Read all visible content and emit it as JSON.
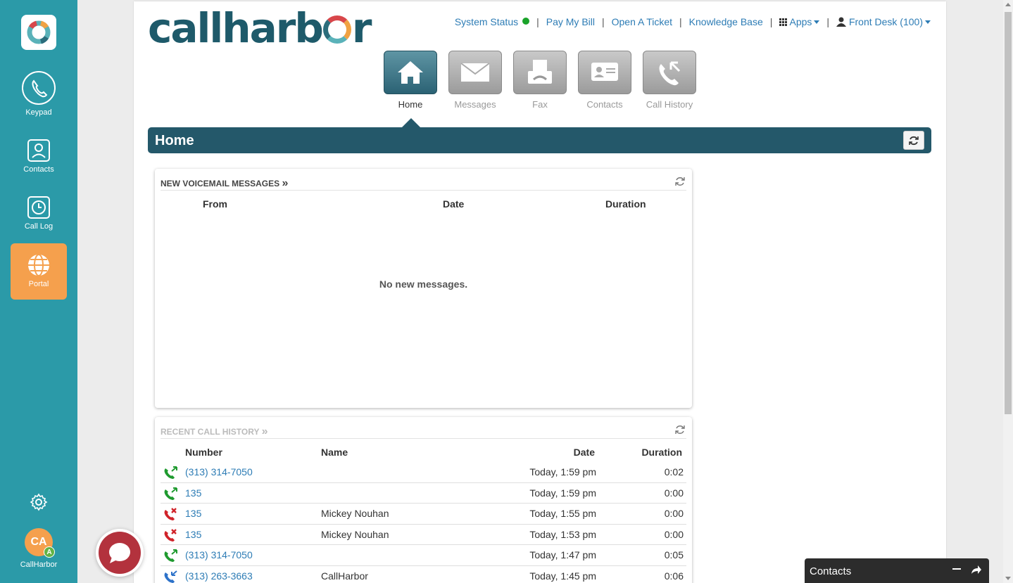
{
  "rail": {
    "items": [
      {
        "label": "Keypad",
        "icon": "phone-icon"
      },
      {
        "label": "Contacts",
        "icon": "contact-card-icon"
      },
      {
        "label": "Call Log",
        "icon": "clock-icon"
      },
      {
        "label": "Portal",
        "icon": "globe-icon"
      }
    ],
    "avatar_initials": "CA",
    "avatar_badge": "A",
    "user_label": "CallHarbor"
  },
  "header": {
    "brand": "callharbor",
    "nav": {
      "system_status": "System Status",
      "pay_bill": "Pay My Bill",
      "open_ticket": "Open A Ticket",
      "knowledge_base": "Knowledge Base",
      "apps": "Apps",
      "user": "Front Desk (100)"
    },
    "status_color": "#1aa32a"
  },
  "tabs": [
    {
      "label": "Home",
      "active": true
    },
    {
      "label": "Messages",
      "active": false
    },
    {
      "label": "Fax",
      "active": false
    },
    {
      "label": "Contacts",
      "active": false
    },
    {
      "label": "Call History",
      "active": false
    }
  ],
  "page": {
    "title": "Home"
  },
  "voicemail": {
    "title": "NEW VOICEMAIL MESSAGES",
    "columns": {
      "from": "From",
      "date": "Date",
      "duration": "Duration"
    },
    "empty": "No new messages."
  },
  "call_history": {
    "title": "RECENT CALL HISTORY",
    "columns": {
      "number": "Number",
      "name": "Name",
      "date": "Date",
      "duration": "Duration"
    },
    "rows": [
      {
        "type": "incoming",
        "number": "(313) 314-7050",
        "name": "",
        "date": "Today, 1:59 pm",
        "duration": "0:02"
      },
      {
        "type": "incoming",
        "number": "135",
        "name": "",
        "date": "Today, 1:59 pm",
        "duration": "0:00"
      },
      {
        "type": "missed",
        "number": "135",
        "name": "Mickey Nouhan",
        "date": "Today, 1:55 pm",
        "duration": "0:00"
      },
      {
        "type": "missed",
        "number": "135",
        "name": "Mickey Nouhan",
        "date": "Today, 1:53 pm",
        "duration": "0:00"
      },
      {
        "type": "incoming",
        "number": "(313) 314-7050",
        "name": "",
        "date": "Today, 1:47 pm",
        "duration": "0:05"
      },
      {
        "type": "outgoing",
        "number": "(313) 263-3663",
        "name": "CallHarbor",
        "date": "Today, 1:45 pm",
        "duration": "0:06"
      }
    ]
  },
  "dock": {
    "title": "Contacts"
  },
  "colors": {
    "rail": "#2b9aa8",
    "accent": "#f5a04d",
    "header_bar": "#24586a",
    "link": "#2d7cb5",
    "incoming": "#1f9a2f",
    "missed": "#d0232a",
    "outgoing": "#2d72c9"
  }
}
